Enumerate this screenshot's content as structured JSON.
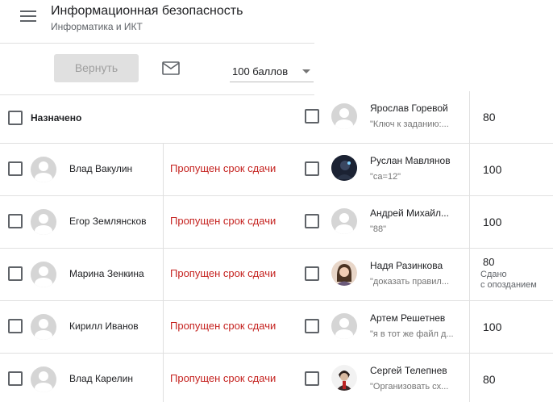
{
  "header": {
    "title": "Информационная безопасность",
    "subtitle": "Информатика и ИКТ",
    "menu_icon": "hamburger-menu-icon"
  },
  "toolbar": {
    "return_label": "Вернуть",
    "mail_icon": "mail-icon",
    "points_value": "100 баллов"
  },
  "left_list": {
    "header_label": "Назначено",
    "rows": [
      {
        "name": "Влад Вакулин",
        "status": "Пропущен срок сдачи"
      },
      {
        "name": "Егор Землянсков",
        "status": "Пропущен срок сдачи"
      },
      {
        "name": "Марина Зенкина",
        "status": "Пропущен срок сдачи"
      },
      {
        "name": "Кирилл Иванов",
        "status": "Пропущен срок сдачи"
      },
      {
        "name": "Влад Карелин",
        "status": "Пропущен срок сдачи"
      }
    ],
    "status_color": "#c5221f"
  },
  "right_list": {
    "rows": [
      {
        "name": "Ярослав Горевой",
        "comment": "\"Ключ к заданию:...",
        "grade": "80",
        "late": ""
      },
      {
        "name": "Руслан Мавлянов",
        "comment": "\"са=12\"",
        "grade": "100",
        "late": ""
      },
      {
        "name": "Андрей Михайл...",
        "comment": "\"88\"",
        "grade": "100",
        "late": ""
      },
      {
        "name": "Надя Разинкова",
        "comment": "\"доказать правил...",
        "grade": "80",
        "late_line1": "Сдано",
        "late_line2": "с опозданием"
      },
      {
        "name": "Артем Решетнев",
        "comment": "\"я в тот же файл д...",
        "grade": "100",
        "late": ""
      },
      {
        "name": "Сергей Телепнев",
        "comment": "\"Организовать сх...",
        "grade": "80",
        "late": ""
      }
    ]
  }
}
